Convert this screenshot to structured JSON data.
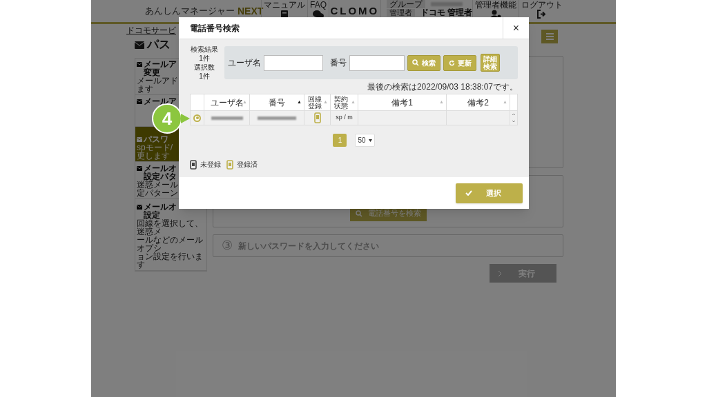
{
  "header": {
    "logo_text": "あんしんマネージャー",
    "logo_accent": "NEXT",
    "manual": "マニュアル",
    "faq": "FAQ",
    "brand": "CLOMO",
    "group_label": "グループ",
    "role_label": "管理者",
    "user_name": "ドコモ 管理者",
    "admin": "管理者機能",
    "logout": "ログアウト"
  },
  "breadcrumb": "ドコモサービ",
  "page_title": "パス",
  "sidebar": [
    {
      "title": [
        "メールア",
        "変更"
      ],
      "desc": [
        "メールアド",
        "ます"
      ],
      "selected": false
    },
    {
      "title": [
        "メールア"
      ],
      "selected": false
    },
    {
      "title": [
        "パスワ"
      ],
      "desc": [
        "spモード/",
        "更します"
      ],
      "selected": true
    },
    {
      "title": [
        "メールオ",
        "設定パタ"
      ],
      "desc": [
        "迷惑メール",
        "定パターン"
      ],
      "selected": false
    },
    {
      "title": [
        "メールオ",
        "設定"
      ],
      "desc": [
        "回線を選択して、迷惑メ",
        "ールなどのメールオプシ",
        "ョン設定を行います"
      ],
      "selected": false
    }
  ],
  "main": {
    "search_button": "電話番号を検索",
    "step3_number": "③",
    "step3_text": "新しいパスワードを入力してください",
    "run_button": "実行"
  },
  "modal": {
    "title": "電話番号検索",
    "close": "×",
    "stats": [
      "検索結果",
      "1件",
      "選択数",
      "1件"
    ],
    "fields": [
      {
        "label": "ユーザ名"
      },
      {
        "label": "番号"
      }
    ],
    "buttons": [
      {
        "label": "検索",
        "kind": "search"
      },
      {
        "label": "更新",
        "kind": "refresh"
      },
      {
        "label": "詳細検索",
        "kind": "plain"
      }
    ],
    "last_search": "最後の検索は2022/09/03 18:38:07です。",
    "table": {
      "columns": [
        {
          "label": "ユーザ名",
          "sort_icon": "▲",
          "sorted": false
        },
        {
          "label": "番号",
          "sort_icon": "▲",
          "sorted": true
        },
        {
          "label": "回線登録",
          "sort_icon": "▲",
          "sorted": false
        },
        {
          "label": "契約状態",
          "sort_icon": "▲",
          "sorted": false
        },
        {
          "label": "備考1",
          "sort_icon": "▲",
          "sorted": false
        },
        {
          "label": "備考2",
          "sort_icon": "▲",
          "sorted": false
        }
      ],
      "rows": [
        {
          "selected": true,
          "registered": true,
          "contract": "sp / m"
        }
      ]
    },
    "pages": [
      {
        "label": "1",
        "selected": true
      }
    ],
    "page_size": "50",
    "legend": [
      {
        "label": "未登録",
        "registered": false
      },
      {
        "label": "登録済",
        "registered": true
      }
    ],
    "confirm": "選択"
  },
  "callout": "4"
}
